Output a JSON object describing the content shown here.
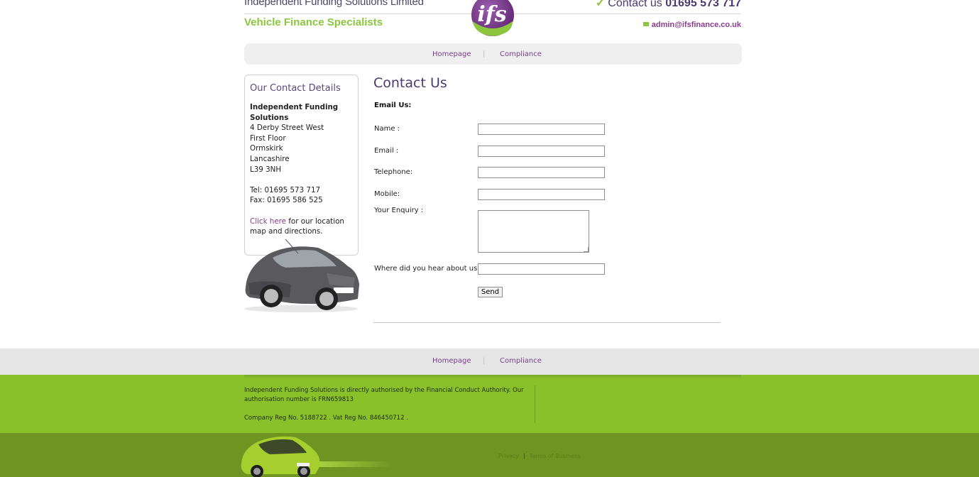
{
  "header": {
    "company_name": "Independent Funding Solutions Limited",
    "tagline": "Vehicle Finance Specialists",
    "logo_text": "ifs",
    "contact_label": "Contact us",
    "contact_number": "01695 573 717",
    "email": "admin@ifsfinance.co.uk"
  },
  "nav": {
    "items": [
      {
        "label": "Homepage"
      },
      {
        "label": "Compliance"
      }
    ],
    "separator": "|"
  },
  "sidebar": {
    "title": "Our Contact Details",
    "company_line1": "Independent Funding",
    "company_line2": "Solutions",
    "address": [
      "4 Derby Street West",
      "First Floor",
      "Ormskirk",
      "Lancashire",
      "L39 3NH"
    ],
    "tel": "Tel: 01695 573 717",
    "fax": "Fax: 01695 586 525",
    "click_here": "Click here",
    "directions_1": " for our location",
    "directions_2": "map and directions."
  },
  "main": {
    "title": "Contact Us",
    "email_us": "Email Us:",
    "fields": {
      "name_label": "Name :",
      "email_label": "Email :",
      "telephone_label": "Telephone:",
      "mobile_label": "Mobile:",
      "enquiry_label": "Your Enquiry :",
      "hear_label": "Where did you hear about us?"
    },
    "values": {
      "name": "",
      "email": "",
      "telephone": "",
      "mobile": "",
      "enquiry": "",
      "hear": ""
    },
    "send_label": "Send"
  },
  "footer": {
    "nav": [
      {
        "label": "Homepage"
      },
      {
        "label": "Compliance"
      }
    ],
    "legal_line": "Independent Funding Solutions is directly authorised by the Financial Conduct Authority. Our authorisation number is FRN659813",
    "reg_line": "Company Reg No. 5188722 . Vat Reg No. 846450712 .",
    "privacy": "Privacy",
    "terms": "Terms of Business"
  },
  "colors": {
    "brand_green": "#8ac12a",
    "brand_purple": "#4a3a70",
    "link_purple": "#7b3d8a"
  }
}
